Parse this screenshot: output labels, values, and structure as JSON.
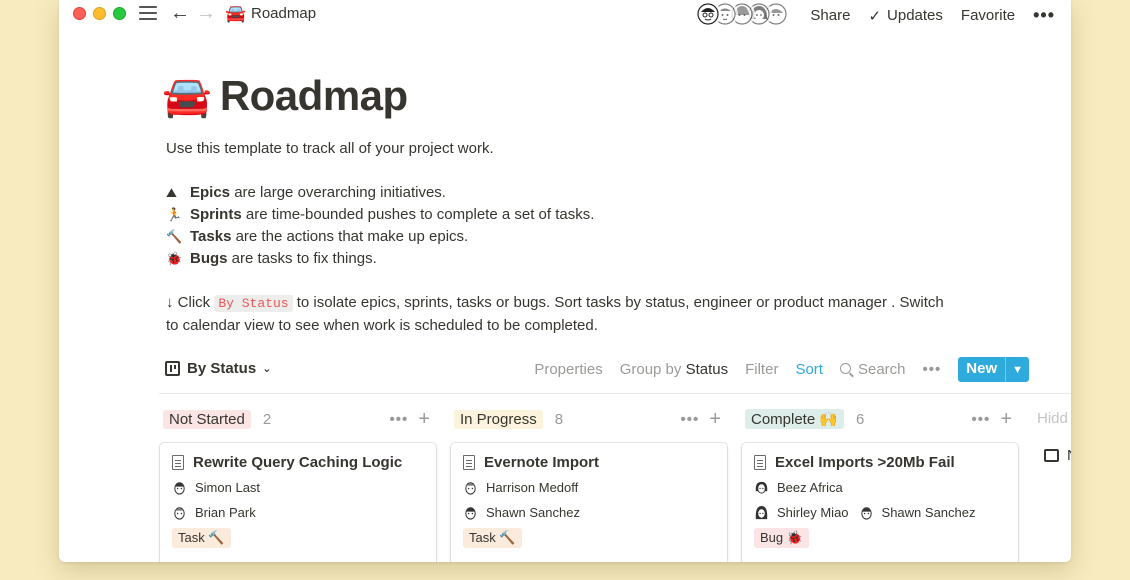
{
  "titlebar": {
    "crumb_emoji": "🚘",
    "crumb_title": "Roadmap",
    "share": "Share",
    "updates": "Updates",
    "favorite": "Favorite",
    "check_glyph": "✓",
    "more_glyph": "•••"
  },
  "page": {
    "emoji": "🚘",
    "title": "Roadmap",
    "intro": "Use this template to track all of your project work.",
    "lines": [
      {
        "emoji": "⛰",
        "bold": "Epics",
        "rest": " are large overarching initiatives."
      },
      {
        "emoji": "🏃",
        "bold": "Sprints",
        "rest": " are time-bounded pushes to complete a set of tasks."
      },
      {
        "emoji": "🔨",
        "bold": "Tasks",
        "rest": " are the actions that make up epics."
      },
      {
        "emoji": "🐞",
        "bold": "Bugs",
        "rest": " are tasks to fix things."
      }
    ],
    "click_prefix": "↓ Click ",
    "click_code": "By Status",
    "click_suffix": " to isolate epics, sprints, tasks or bugs. Sort tasks by status, engineer or product manager . Switch",
    "click_line2": "to calendar view to see when work is scheduled to be completed."
  },
  "view": {
    "name": "By Status",
    "properties": "Properties",
    "group_by": "Group by",
    "group_value": "Status",
    "filter": "Filter",
    "sort": "Sort",
    "search": "Search",
    "more": "•••",
    "new": "New"
  },
  "columns": [
    {
      "label": "Not Started",
      "count": "2",
      "color": "#fbe4e4"
    },
    {
      "label": "In Progress",
      "count": "8",
      "color": "#fbf3db"
    },
    {
      "label": "Complete 🙌",
      "count": "6",
      "color": "#ddedea"
    }
  ],
  "hidden": {
    "label": "Hidd",
    "item": "N"
  },
  "cards": [
    {
      "title": "Rewrite Query Caching Logic",
      "people_rows": [
        [
          "Simon Last"
        ],
        [
          "Brian Park"
        ]
      ],
      "tag": "Task 🔨",
      "tag_color": "#faebdd"
    },
    {
      "title": "Evernote Import",
      "people_rows": [
        [
          "Harrison Medoff"
        ],
        [
          "Shawn Sanchez"
        ]
      ],
      "tag": "Task 🔨",
      "tag_color": "#faebdd"
    },
    {
      "title": "Excel Imports >20Mb Fail",
      "people_rows": [
        [
          "Beez Africa"
        ],
        [
          "Shirley Miao",
          "Shawn Sanchez"
        ]
      ],
      "tag": "Bug 🐞",
      "tag_color": "#fbe4e4"
    }
  ],
  "help": "?"
}
